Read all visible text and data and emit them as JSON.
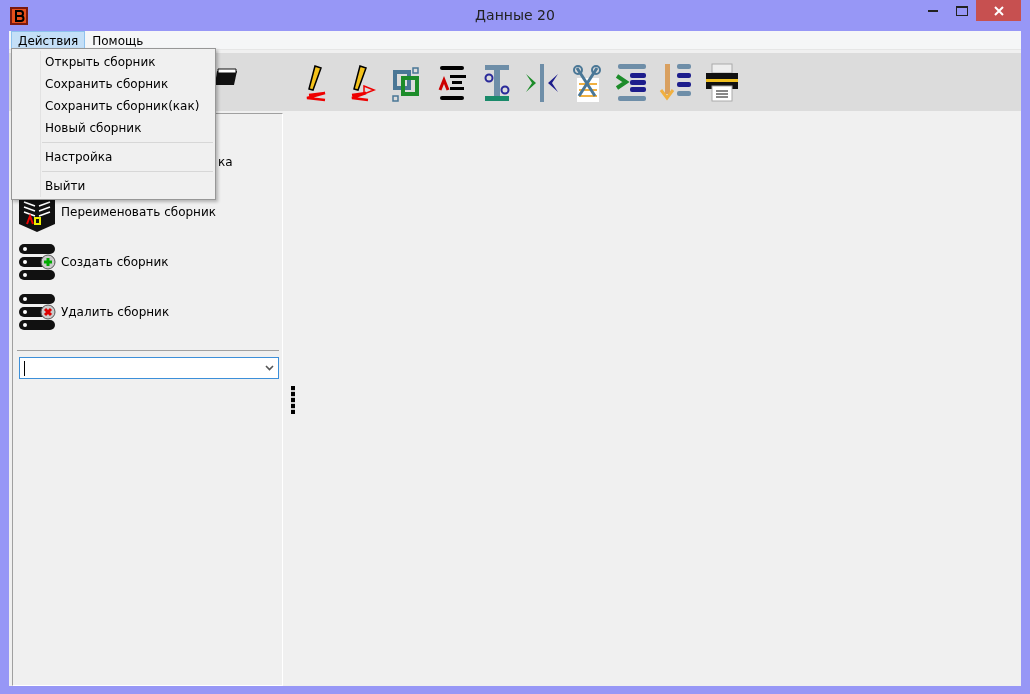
{
  "window": {
    "title": "Данные 20"
  },
  "menu_bar": [
    {
      "label": "Действия",
      "selected": true
    },
    {
      "label": "Помощь",
      "selected": false
    }
  ],
  "open_menu": {
    "items": [
      {
        "kind": "item",
        "label": "Открыть сборник"
      },
      {
        "kind": "item",
        "label": "Сохранить сборник"
      },
      {
        "kind": "item",
        "label": "Сохранить сборник(как)"
      },
      {
        "kind": "item",
        "label": "Новый сборник"
      },
      {
        "kind": "separator"
      },
      {
        "kind": "item",
        "label": "Настройка"
      },
      {
        "kind": "separator"
      },
      {
        "kind": "item",
        "label": "Выйти"
      }
    ]
  },
  "sidebar": {
    "items": [
      {
        "kind": "hidden",
        "label": "ка"
      },
      {
        "kind": "book",
        "label": "Переименовать сборник"
      },
      {
        "kind": "add",
        "label": "Создать сборник"
      },
      {
        "kind": "remove",
        "label": "Удалить сборник"
      }
    ]
  }
}
